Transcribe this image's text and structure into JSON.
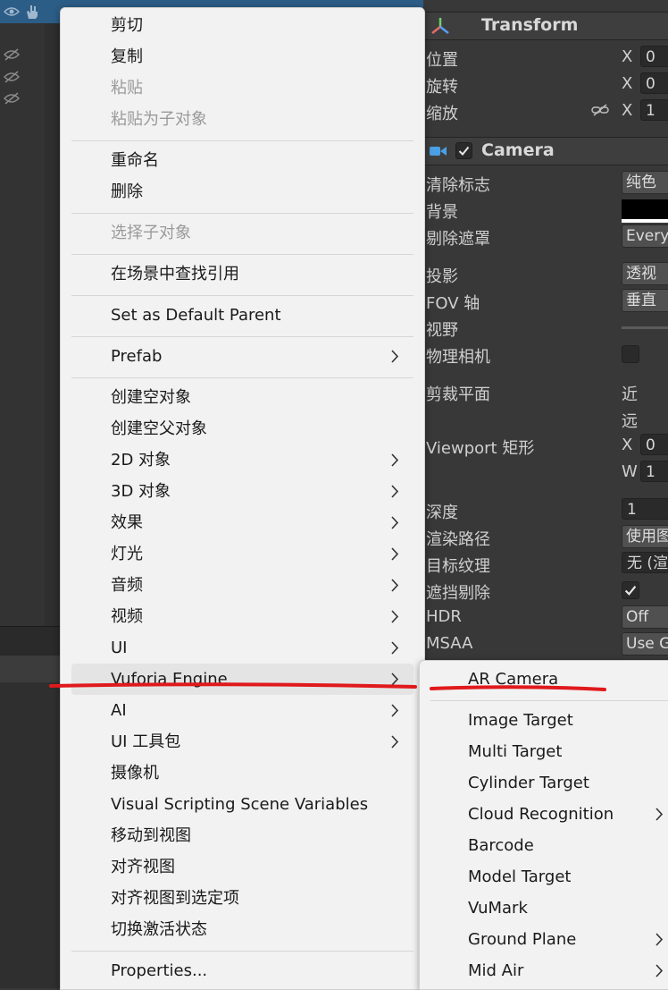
{
  "colors": {
    "menu_bg": "#f2f2f2",
    "menu_text": "#1a1a1a",
    "menu_disabled_text": "#9a9a9a",
    "hover_bg": "#e4e4e4",
    "annotation": "#e0191c",
    "selection": "#2c5d87",
    "inspector_bg": "#383838"
  },
  "hierarchy": {
    "icons": [
      "eye-icon",
      "hand-icon",
      "eye-hidden-icon"
    ]
  },
  "inspector": {
    "transform": {
      "title": "Transform",
      "rows": [
        {
          "label": "位置",
          "axis": "X",
          "value": "0"
        },
        {
          "label": "旋转",
          "axis": "X",
          "value": "0"
        },
        {
          "label": "缩放",
          "axis": "X",
          "value": "1"
        }
      ]
    },
    "camera": {
      "title": "Camera",
      "clear_flags": {
        "label": "清除标志",
        "value": "纯色"
      },
      "background": {
        "label": "背景",
        "color": "#000000"
      },
      "culling_mask": {
        "label": "剔除遮罩",
        "value": "Every"
      },
      "projection": {
        "label": "投影",
        "value": "透视"
      },
      "fov_axis": {
        "label": "FOV 轴",
        "value": "垂直"
      },
      "field_of_view": {
        "label": "视野"
      },
      "physical_camera": {
        "label": "物理相机",
        "checked": false
      },
      "clipping": {
        "label": "剪裁平面",
        "near": "近",
        "far": "远"
      },
      "viewport": {
        "label": "Viewport 矩形",
        "x_axis": "X",
        "x_value": "0",
        "w_axis": "W",
        "w_value": "1"
      },
      "depth": {
        "label": "深度",
        "value": "1"
      },
      "render_path": {
        "label": "渲染路径",
        "value": "使用图"
      },
      "target_texture": {
        "label": "目标纹理",
        "value": "无 (渲"
      },
      "occlusion_culling": {
        "label": "遮挡剔除",
        "checked": true
      },
      "hdr": {
        "label": "HDR",
        "value": "Off"
      },
      "msaa": {
        "label": "MSAA",
        "value": "Use G"
      }
    }
  },
  "context_menu": {
    "items": [
      {
        "label": "剪切",
        "disabled": false,
        "submenu": false
      },
      {
        "label": "复制",
        "disabled": false,
        "submenu": false
      },
      {
        "label": "粘贴",
        "disabled": true,
        "submenu": false
      },
      {
        "label": "粘贴为子对象",
        "disabled": true,
        "submenu": false
      },
      {
        "label": "重命名",
        "disabled": false,
        "submenu": false
      },
      {
        "label": "删除",
        "disabled": false,
        "submenu": false
      },
      {
        "label": "选择子对象",
        "disabled": true,
        "submenu": false
      },
      {
        "label": "在场景中查找引用",
        "disabled": false,
        "submenu": false
      },
      {
        "label": "Set as Default Parent",
        "disabled": false,
        "submenu": false
      },
      {
        "label": "Prefab",
        "disabled": false,
        "submenu": true
      },
      {
        "label": "创建空对象",
        "disabled": false,
        "submenu": false
      },
      {
        "label": "创建空父对象",
        "disabled": false,
        "submenu": false
      },
      {
        "label": "2D 对象",
        "disabled": false,
        "submenu": true
      },
      {
        "label": "3D 对象",
        "disabled": false,
        "submenu": true
      },
      {
        "label": "效果",
        "disabled": false,
        "submenu": true
      },
      {
        "label": "灯光",
        "disabled": false,
        "submenu": true
      },
      {
        "label": "音频",
        "disabled": false,
        "submenu": true
      },
      {
        "label": "视频",
        "disabled": false,
        "submenu": true
      },
      {
        "label": "UI",
        "disabled": false,
        "submenu": true
      },
      {
        "label": "Vuforia Engine",
        "disabled": false,
        "submenu": true,
        "highlighted": true
      },
      {
        "label": "AI",
        "disabled": false,
        "submenu": true
      },
      {
        "label": "UI 工具包",
        "disabled": false,
        "submenu": true
      },
      {
        "label": "摄像机",
        "disabled": false,
        "submenu": false
      },
      {
        "label": "Visual Scripting Scene Variables",
        "disabled": false,
        "submenu": false
      },
      {
        "label": "移动到视图",
        "disabled": false,
        "submenu": false
      },
      {
        "label": "对齐视图",
        "disabled": false,
        "submenu": false
      },
      {
        "label": "对齐视图到选定项",
        "disabled": false,
        "submenu": false
      },
      {
        "label": "切换激活状态",
        "disabled": false,
        "submenu": false
      },
      {
        "label": "Properties...",
        "disabled": false,
        "submenu": false
      }
    ]
  },
  "submenu": {
    "items": [
      {
        "label": "AR Camera",
        "submenu": false
      },
      {
        "label": "Image Target",
        "submenu": false
      },
      {
        "label": "Multi Target",
        "submenu": false
      },
      {
        "label": "Cylinder Target",
        "submenu": false
      },
      {
        "label": "Cloud Recognition",
        "submenu": true
      },
      {
        "label": "Barcode",
        "submenu": false
      },
      {
        "label": "Model Target",
        "submenu": false
      },
      {
        "label": "VuMark",
        "submenu": false
      },
      {
        "label": "Ground Plane",
        "submenu": true
      },
      {
        "label": "Mid Air",
        "submenu": true
      }
    ]
  }
}
